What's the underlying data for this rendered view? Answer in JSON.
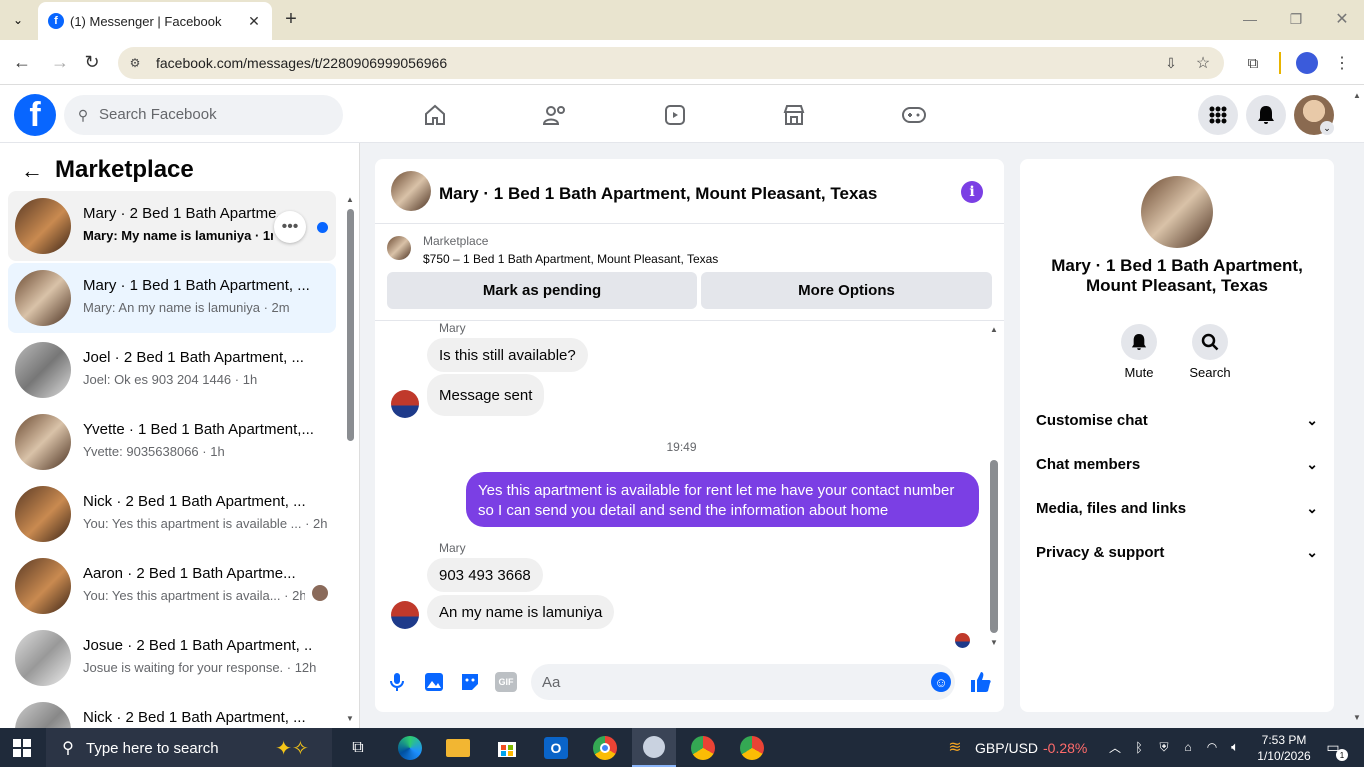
{
  "browser": {
    "tab_title": "(1) Messenger | Facebook",
    "url": "facebook.com/messages/t/2280906999056966"
  },
  "fb": {
    "search_placeholder": "Search Facebook",
    "brand_color": "#0866ff"
  },
  "left": {
    "title": "Marketplace",
    "conversations": [
      {
        "title": "Mary · 2 Bed 1 Bath Apartme...",
        "snippet": "Mary: My name is lamuniya · 1m",
        "unread": true
      },
      {
        "title": "Mary · 1 Bed 1 Bath Apartment, ...",
        "snippet": "Mary: An my name is lamuniya · 2m"
      },
      {
        "title": "Joel · 2 Bed 1 Bath Apartment, ...",
        "snippet": "Joel: Ok es 903 204 1446 · 1h"
      },
      {
        "title": "Yvette · 1 Bed 1 Bath Apartment,...",
        "snippet": "Yvette: 9035638066 · 1h"
      },
      {
        "title": "Nick · 2 Bed 1 Bath Apartment, ...",
        "snippet": "You: Yes this apartment is available ... · 2h"
      },
      {
        "title": "Aaron · 2 Bed 1 Bath Apartme...",
        "snippet": "You: Yes this apartment is availa... · 2h"
      },
      {
        "title": "Josue · 2 Bed 1 Bath Apartment, ...",
        "snippet": "Josue is waiting for your response. · 12h"
      },
      {
        "title": "Nick · 2 Bed 1 Bath Apartment, ...",
        "snippet": ""
      }
    ]
  },
  "chat": {
    "header_title": "Mary · 1 Bed 1 Bath Apartment, Mount Pleasant, Texas",
    "listing": {
      "label": "Marketplace",
      "detail": "$750 – 1 Bed 1 Bath Apartment, Mount Pleasant, Texas"
    },
    "mark_pending": "Mark as pending",
    "more_options": "More Options",
    "sender_name": "Mary",
    "msg1": "Is this still available?",
    "msg2": "Message sent",
    "time": "19:49",
    "my_msg_line1": "Yes this apartment is available for rent let me have your contact number",
    "my_msg_line2": "so I can send you detail and send the information about home",
    "msg3": "903 493 3668",
    "msg4": "An my name is lamuniya",
    "composer_placeholder": "Aa",
    "accent": "#7b3fe4"
  },
  "right": {
    "title_line1": "Mary · 1 Bed 1 Bath Apartment,",
    "title_line2": "Mount Pleasant, Texas",
    "mute": "Mute",
    "search": "Search",
    "sections": [
      "Customise chat",
      "Chat members",
      "Media, files and links",
      "Privacy & support"
    ]
  },
  "taskbar": {
    "search_placeholder": "Type here to search",
    "ticker": "GBP/USD",
    "ticker_change": "-0.28%",
    "time": "7:53 PM",
    "date": "1/10/2026",
    "notifications": "1"
  }
}
